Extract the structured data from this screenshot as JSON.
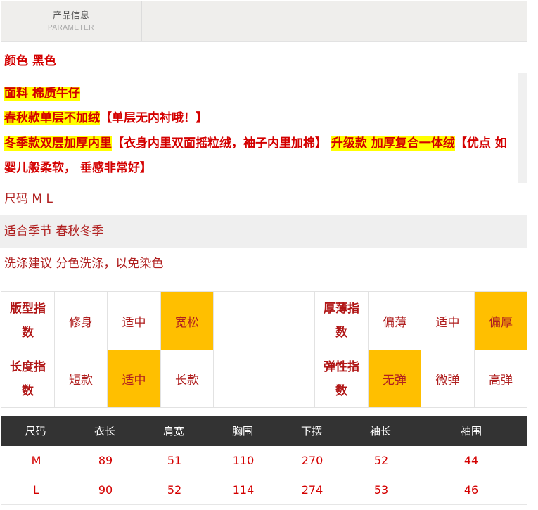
{
  "header": {
    "title": "产品信息",
    "subtitle": "PARAMETER"
  },
  "info": {
    "color": "颜色 黑色",
    "fabric": "面料 棉质牛仔",
    "spring_hl": "春秋款单层不加绒",
    "spring_note": "【单层无内衬哦！】",
    "winter_hl": "冬季款双层加厚内里",
    "winter_note": "【衣身内里双面摇粒绒，袖子内里加棉】",
    "upgrade_hl": "升级款 加厚复合一体绒",
    "upgrade_note": "【优点 如婴儿般柔软， 垂感非常好】",
    "size": "尺码 M L",
    "season": "适合季节 春秋冬季",
    "wash": "洗涤建议 分色洗涤，以免染色"
  },
  "indices": {
    "fit": {
      "label": "版型指数",
      "options": [
        "修身",
        "适中",
        "宽松"
      ],
      "selected": "宽松"
    },
    "thickness": {
      "label": "厚薄指数",
      "options": [
        "偏薄",
        "适中",
        "偏厚"
      ],
      "selected": "偏厚"
    },
    "length": {
      "label": "长度指数",
      "options": [
        "短款",
        "适中",
        "长款"
      ],
      "selected": "适中"
    },
    "elasticity": {
      "label": "弹性指数",
      "options": [
        "无弹",
        "微弹",
        "高弹"
      ],
      "selected": "无弹"
    }
  },
  "size_table": {
    "headers": [
      "尺码",
      "衣长",
      "肩宽",
      "胸围",
      "下摆",
      "袖长",
      "袖围"
    ],
    "rows": [
      [
        "M",
        "89",
        "51",
        "110",
        "270",
        "52",
        "44"
      ],
      [
        "L",
        "90",
        "52",
        "114",
        "274",
        "53",
        "46"
      ]
    ]
  },
  "colors": {
    "accent_red": "#d40000",
    "highlight": "#ffff00",
    "selected": "#ffbf00",
    "table_head": "#333333"
  }
}
